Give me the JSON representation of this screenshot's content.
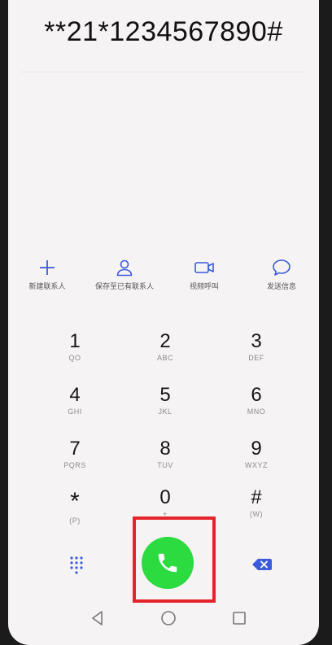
{
  "display": {
    "number": "**21*1234567890#"
  },
  "actions": [
    {
      "label": "新建联系人",
      "icon": "plus-icon"
    },
    {
      "label": "保存至已有联系人",
      "icon": "person-icon"
    },
    {
      "label": "视频呼叫",
      "icon": "video-camera-icon"
    },
    {
      "label": "发送信息",
      "icon": "message-bubble-icon"
    }
  ],
  "keypad": [
    {
      "digit": "1",
      "letters": "QO"
    },
    {
      "digit": "2",
      "letters": "ABC"
    },
    {
      "digit": "3",
      "letters": "DEF"
    },
    {
      "digit": "4",
      "letters": "GHI"
    },
    {
      "digit": "5",
      "letters": "JKL"
    },
    {
      "digit": "6",
      "letters": "MNO"
    },
    {
      "digit": "7",
      "letters": "PQRS"
    },
    {
      "digit": "8",
      "letters": "TUV"
    },
    {
      "digit": "9",
      "letters": "WXYZ"
    },
    {
      "digit": "*",
      "letters": "(P)"
    },
    {
      "digit": "0",
      "letters": "+"
    },
    {
      "digit": "#",
      "letters": "(W)"
    }
  ],
  "bottom": {
    "left_icon": "dialpad-grid-icon",
    "center_icon": "phone-handset-icon",
    "right_icon": "backspace-icon",
    "call_color": "#2bdb3f",
    "highlight_color": "#e3242b",
    "accent_color": "#3b5bdb"
  },
  "navbar": [
    "back-triangle-icon",
    "home-circle-icon",
    "recents-square-icon"
  ]
}
